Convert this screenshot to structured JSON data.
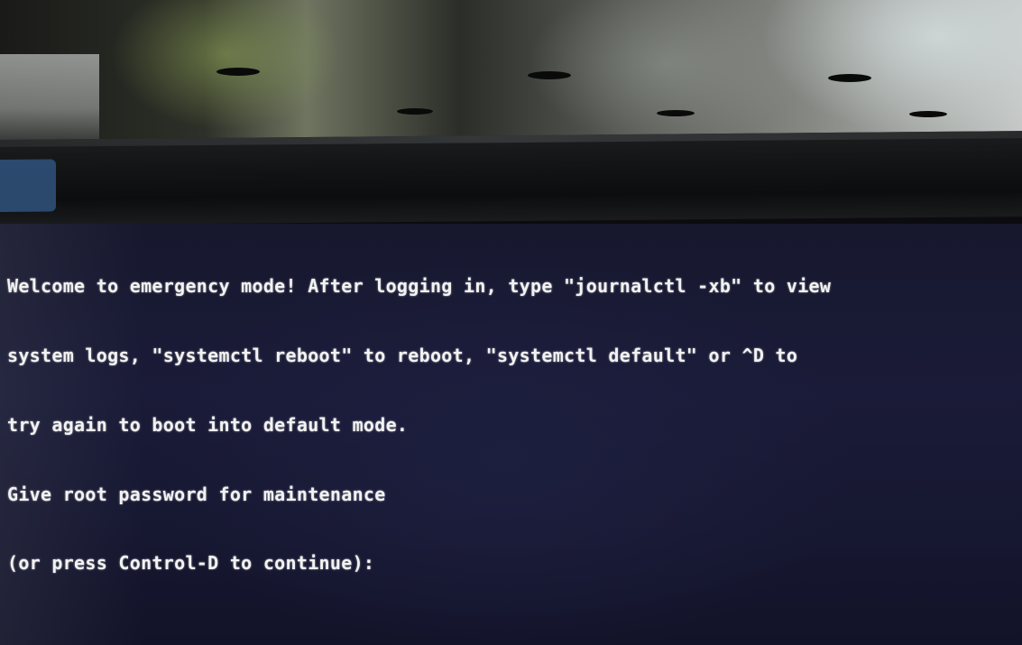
{
  "terminal": {
    "lines": [
      "Welcome to emergency mode! After logging in, type \"journalctl -xb\" to view",
      "system logs, \"systemctl reboot\" to reboot, \"systemctl default\" or ^D to",
      "try again to boot into default mode.",
      "Give root password for maintenance",
      "(or press Control-D to continue):"
    ]
  },
  "colors": {
    "screen_background": "#17182e",
    "terminal_text": "#f2f2f2",
    "bezel": "#131416"
  }
}
